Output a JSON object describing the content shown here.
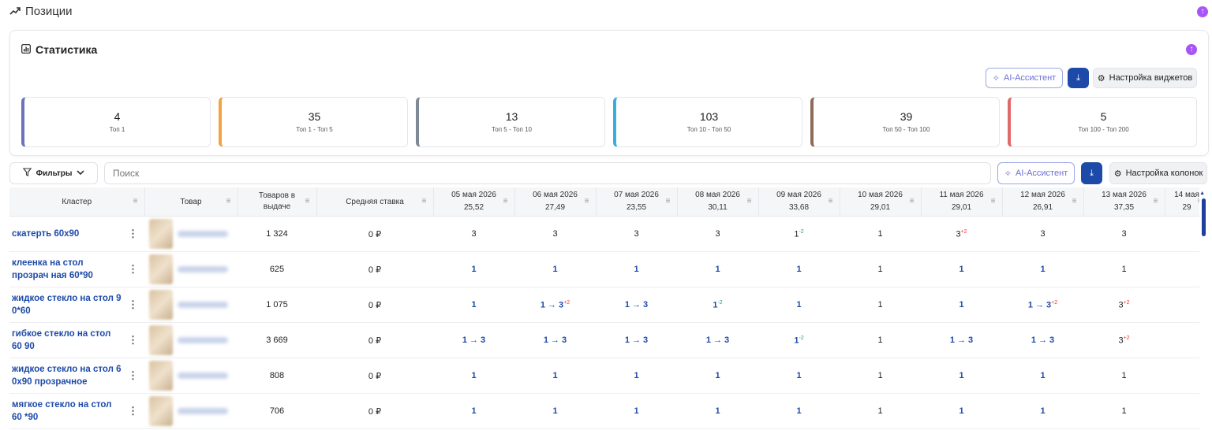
{
  "section_title": "Позиции",
  "stats": {
    "title": "Статистика",
    "ai_label": "AI-Ассистент",
    "settings_label": "Настройка виджетов",
    "tiles": [
      {
        "value": "4",
        "label": "Топ 1",
        "color": "#6b74b8"
      },
      {
        "value": "35",
        "label": "Топ 1 - Топ 5",
        "color": "#f2a243"
      },
      {
        "value": "13",
        "label": "Топ 5 - Топ 10",
        "color": "#7d8a96"
      },
      {
        "value": "103",
        "label": "Топ 10 - Топ 50",
        "color": "#3aaee0"
      },
      {
        "value": "39",
        "label": "Топ 50 - Топ 100",
        "color": "#8c6b5a"
      },
      {
        "value": "5",
        "label": "Топ 100 - Топ 200",
        "color": "#e06a6a"
      }
    ]
  },
  "toolbar": {
    "filters_label": "Фильтры",
    "search_placeholder": "Поиск",
    "ai_label": "AI-Ассистент",
    "columns_label": "Настройка колонок"
  },
  "table": {
    "col_cluster": "Кластер",
    "col_product": "Товар",
    "col_items": "Товаров в выдаче",
    "col_bid": "Средняя ставка",
    "dates": [
      {
        "date": "05 мая 2026",
        "avg": "25,52"
      },
      {
        "date": "06 мая 2026",
        "avg": "27,49"
      },
      {
        "date": "07 мая 2026",
        "avg": "23,55"
      },
      {
        "date": "08 мая 2026",
        "avg": "30,11"
      },
      {
        "date": "09 мая 2026",
        "avg": "33,68"
      },
      {
        "date": "10 мая 2026",
        "avg": "29,01"
      },
      {
        "date": "11 мая 2026",
        "avg": "29,01"
      },
      {
        "date": "12 мая 2026",
        "avg": "26,91"
      },
      {
        "date": "13 мая 2026",
        "avg": "37,35"
      },
      {
        "date": "14 мая",
        "avg": "29"
      }
    ],
    "rows": [
      {
        "cluster": "скатерть 60х90",
        "items": "1 324",
        "bid": "0 ₽",
        "cells": [
          [
            "3",
            "p",
            ""
          ],
          [
            "3",
            "p",
            ""
          ],
          [
            "3",
            "p",
            ""
          ],
          [
            "3",
            "p",
            ""
          ],
          [
            "1",
            "p",
            "-2"
          ],
          [
            "1",
            "p",
            ""
          ],
          [
            "3",
            "p",
            "+2"
          ],
          [
            "3",
            "p",
            ""
          ],
          [
            "3",
            "p",
            ""
          ],
          [
            "",
            "",
            " "
          ]
        ]
      },
      {
        "cluster": "клеенка на стол прозрач ная 60*90",
        "items": "625",
        "bid": "0 ₽",
        "cells": [
          [
            "1",
            "b",
            ""
          ],
          [
            "1",
            "b",
            ""
          ],
          [
            "1",
            "b",
            ""
          ],
          [
            "1",
            "b",
            ""
          ],
          [
            "1",
            "b",
            ""
          ],
          [
            "1",
            "p",
            ""
          ],
          [
            "1",
            "b",
            ""
          ],
          [
            "1",
            "b",
            ""
          ],
          [
            "1",
            "p",
            ""
          ],
          [
            "",
            "",
            ""
          ]
        ]
      },
      {
        "cluster": "жидкое стекло на стол 9 0*60",
        "items": "1 075",
        "bid": "0 ₽",
        "cells": [
          [
            "1",
            "b",
            ""
          ],
          [
            "1 → 3",
            "a",
            "+2"
          ],
          [
            "1 → 3",
            "a",
            ""
          ],
          [
            "1",
            "b",
            "-2"
          ],
          [
            "1",
            "b",
            ""
          ],
          [
            "1",
            "p",
            ""
          ],
          [
            "1",
            "b",
            ""
          ],
          [
            "1 → 3",
            "a",
            "+2"
          ],
          [
            "3",
            "p",
            "+2"
          ],
          [
            "",
            "",
            ""
          ]
        ]
      },
      {
        "cluster": "гибкое стекло на стол 60 90",
        "items": "3 669",
        "bid": "0 ₽",
        "cells": [
          [
            "1 → 3",
            "a",
            ""
          ],
          [
            "1 → 3",
            "a",
            ""
          ],
          [
            "1 → 3",
            "a",
            ""
          ],
          [
            "1 → 3",
            "a",
            ""
          ],
          [
            "1",
            "b",
            "-2"
          ],
          [
            "1",
            "p",
            ""
          ],
          [
            "1 → 3",
            "a",
            ""
          ],
          [
            "1 → 3",
            "a",
            ""
          ],
          [
            "3",
            "p",
            "+2"
          ],
          [
            "",
            "",
            ""
          ]
        ]
      },
      {
        "cluster": "жидкое стекло на стол 6 0х90 прозрачное",
        "items": "808",
        "bid": "0 ₽",
        "cells": [
          [
            "1",
            "b",
            ""
          ],
          [
            "1",
            "b",
            ""
          ],
          [
            "1",
            "b",
            ""
          ],
          [
            "1",
            "b",
            ""
          ],
          [
            "1",
            "b",
            ""
          ],
          [
            "1",
            "p",
            ""
          ],
          [
            "1",
            "b",
            ""
          ],
          [
            "1",
            "b",
            ""
          ],
          [
            "1",
            "p",
            ""
          ],
          [
            "",
            "",
            ""
          ]
        ]
      },
      {
        "cluster": "мягкое стекло на стол 60 *90",
        "items": "706",
        "bid": "0 ₽",
        "cells": [
          [
            "1",
            "b",
            ""
          ],
          [
            "1",
            "b",
            ""
          ],
          [
            "1",
            "b",
            ""
          ],
          [
            "1",
            "b",
            ""
          ],
          [
            "1",
            "b",
            ""
          ],
          [
            "1",
            "p",
            ""
          ],
          [
            "1",
            "b",
            ""
          ],
          [
            "1",
            "b",
            ""
          ],
          [
            "1",
            "p",
            ""
          ],
          [
            "",
            "",
            ""
          ]
        ]
      }
    ]
  }
}
